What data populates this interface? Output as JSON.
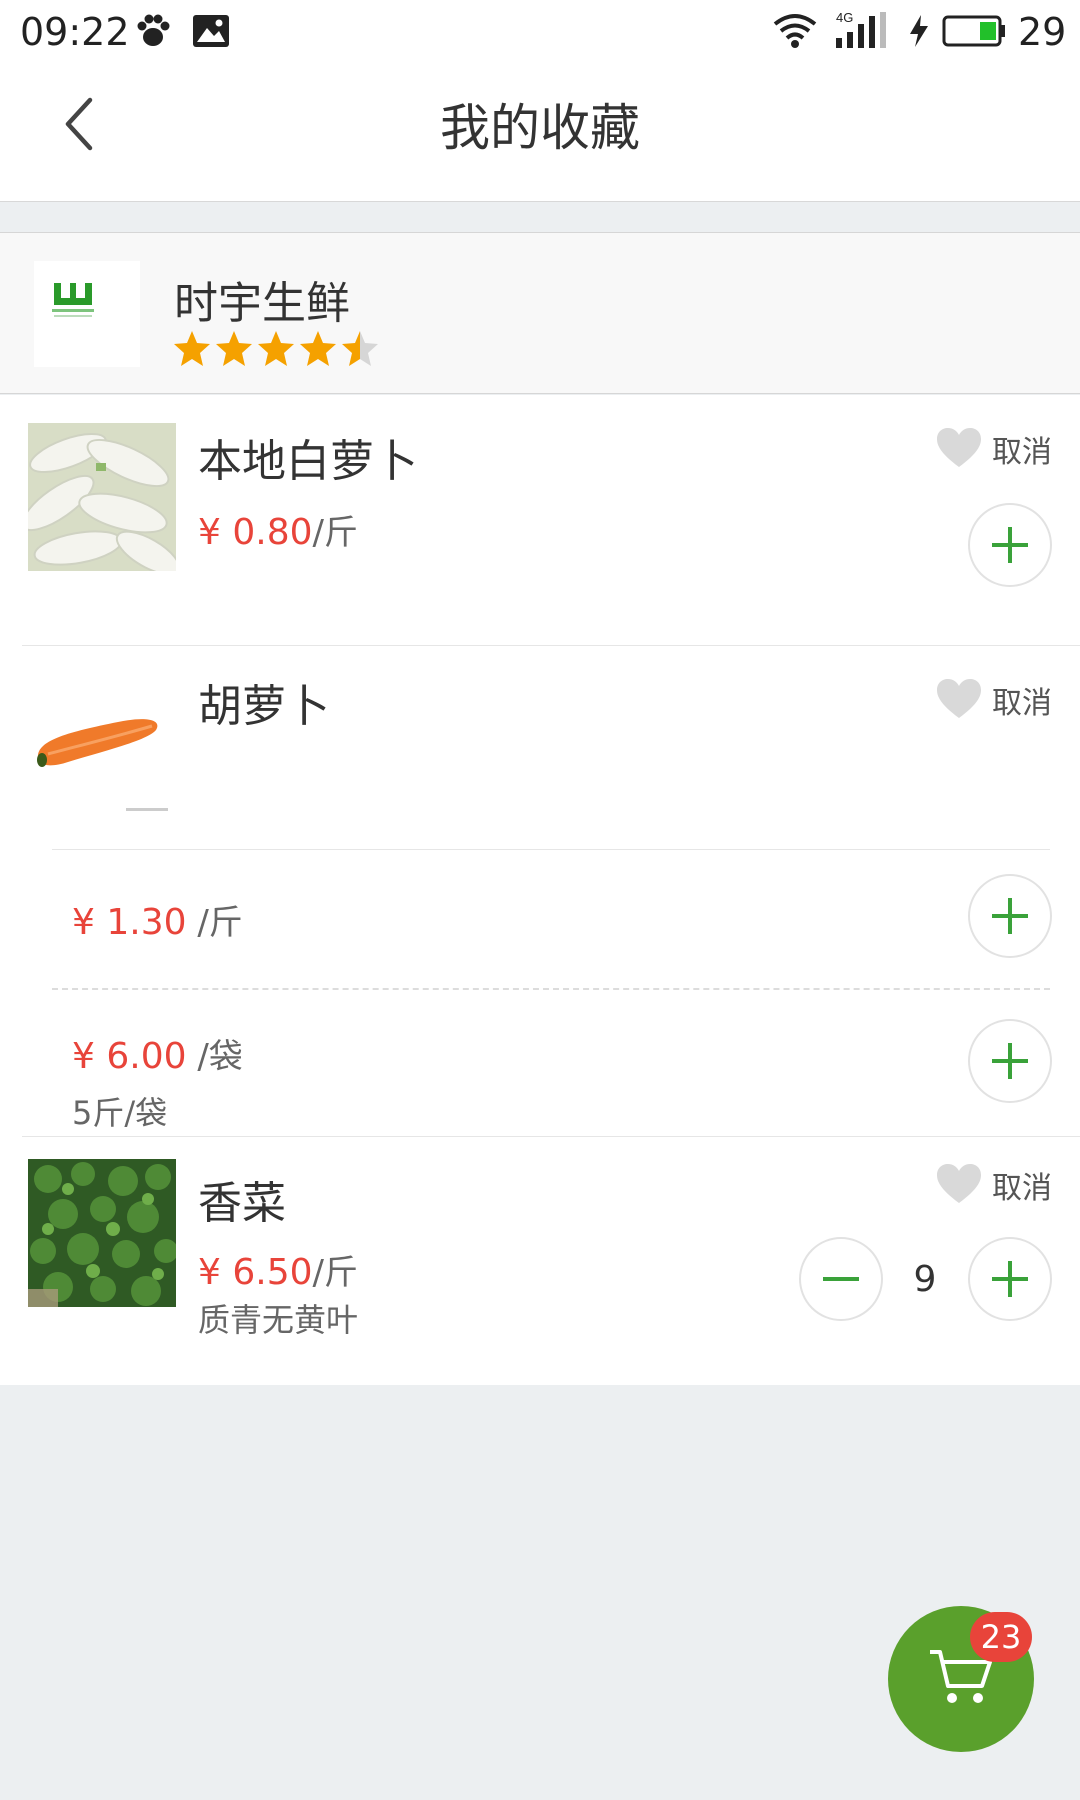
{
  "status_bar": {
    "time": "09:22",
    "network": "4G",
    "battery_level": "29",
    "icons": [
      "paw-icon",
      "image-icon",
      "wifi-icon",
      "signal-icon",
      "charging-icon",
      "battery-icon"
    ]
  },
  "nav": {
    "title": "我的收藏",
    "back_icon": "chevron-left-icon"
  },
  "shop": {
    "name": "时宇生鲜",
    "rating": 4.5,
    "rating_max": 5,
    "star_color": "#f5a100"
  },
  "products": [
    {
      "name": "本地白萝卜",
      "price": "¥ 0.80",
      "unit": "/斤",
      "cancel_label": "取消"
    },
    {
      "name": "胡萝卜",
      "cancel_label": "取消",
      "variants": [
        {
          "price": "¥ 1.30",
          "unit": " /斤"
        },
        {
          "price": "¥ 6.00",
          "unit": " /袋",
          "spec": "5斤/袋"
        }
      ]
    },
    {
      "name": "香菜",
      "price": "¥ 6.50",
      "unit": "/斤",
      "description": "质青无黄叶",
      "cancel_label": "取消",
      "quantity": "9"
    }
  ],
  "cart": {
    "badge_count": "23",
    "color": "#5aa02c",
    "badge_color": "#e8443a"
  },
  "colors": {
    "accent_green": "#3aa23a",
    "price_red": "#e8443a"
  }
}
